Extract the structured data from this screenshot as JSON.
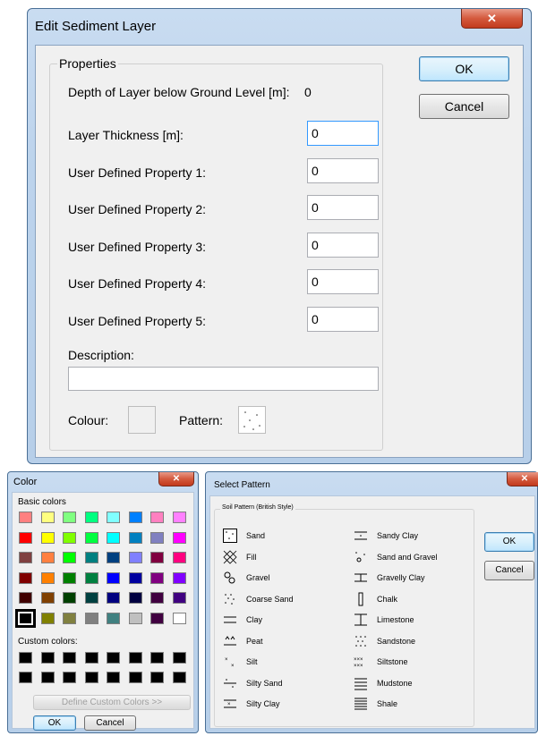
{
  "edit_dialog": {
    "title": "Edit Sediment Layer",
    "close_glyph": "✕",
    "group_label": "Properties",
    "depth_label": "Depth of Layer below Ground Level [m]:",
    "depth_value": "0",
    "fields": [
      {
        "label": "Layer Thickness [m]:",
        "value": "0"
      },
      {
        "label": "User Defined Property 1:",
        "value": "0"
      },
      {
        "label": "User Defined Property 2:",
        "value": "0"
      },
      {
        "label": "User Defined Property 3:",
        "value": "0"
      },
      {
        "label": "User Defined Property 4:",
        "value": "0"
      },
      {
        "label": "User Defined Property 5:",
        "value": "0"
      }
    ],
    "description_label": "Description:",
    "description_value": "",
    "colour_label": "Colour:",
    "pattern_label": "Pattern:",
    "ok_label": "OK",
    "cancel_label": "Cancel"
  },
  "color_dialog": {
    "title": "Color",
    "close_glyph": "✕",
    "basic_label": "Basic colors",
    "basic_colors": [
      [
        "#ff8080",
        "#ffff80",
        "#80ff80",
        "#00ff80",
        "#80ffff",
        "#0080ff",
        "#ff80c0",
        "#ff80ff"
      ],
      [
        "#ff0000",
        "#ffff00",
        "#80ff00",
        "#00ff40",
        "#00ffff",
        "#0080c0",
        "#8080c0",
        "#ff00ff"
      ],
      [
        "#804040",
        "#ff8040",
        "#00ff00",
        "#008080",
        "#004080",
        "#8080ff",
        "#800040",
        "#ff0080"
      ],
      [
        "#800000",
        "#ff8000",
        "#008000",
        "#008040",
        "#0000ff",
        "#0000a0",
        "#800080",
        "#8000ff"
      ],
      [
        "#400000",
        "#804000",
        "#004000",
        "#004040",
        "#000080",
        "#000040",
        "#400040",
        "#400080"
      ],
      [
        "#000000",
        "#808000",
        "#808040",
        "#808080",
        "#408080",
        "#c0c0c0",
        "#400040",
        "#ffffff"
      ]
    ],
    "selected_index": [
      5,
      0
    ],
    "custom_label": "Custom colors:",
    "custom_color": "#000000",
    "define_label": "Define Custom Colors >>",
    "ok_label": "OK",
    "cancel_label": "Cancel"
  },
  "pattern_dialog": {
    "title": "Select Pattern",
    "close_glyph": "✕",
    "group_label": "Soil Pattern (British Style)",
    "col1": [
      "Sand",
      "Fill",
      "Gravel",
      "Coarse Sand",
      "Clay",
      "Peat",
      "Silt",
      "Silty Sand",
      "Silty Clay"
    ],
    "col2": [
      "Sandy Clay",
      "Sand and Gravel",
      "Gravelly Clay",
      "Chalk",
      "Limestone",
      "Sandstone",
      "Siltstone",
      "Mudstone",
      "Shale"
    ],
    "ok_label": "OK",
    "cancel_label": "Cancel"
  }
}
